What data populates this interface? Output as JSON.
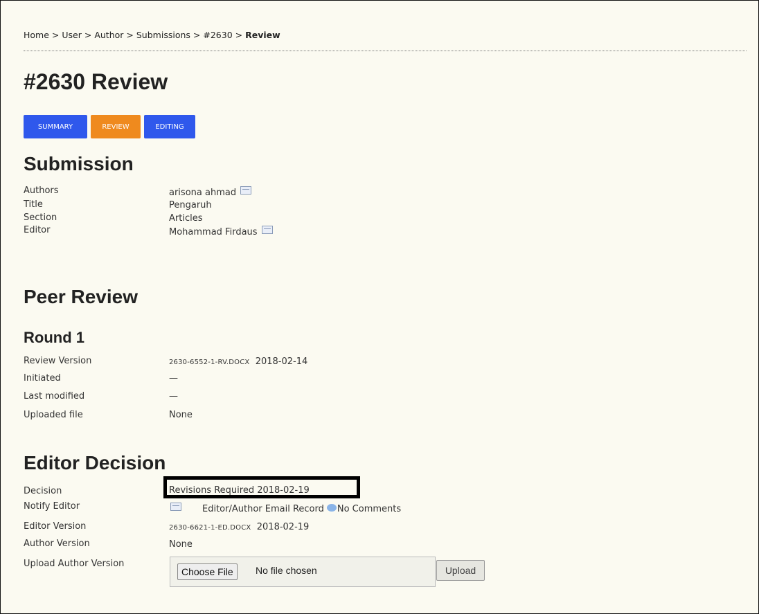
{
  "breadcrumb": {
    "items": [
      "Home",
      "User",
      "Author",
      "Submissions",
      "#2630"
    ],
    "separator": ">",
    "current": "Review"
  },
  "page_title": "#2630 Review",
  "tabs": [
    {
      "label": "SUMMARY",
      "active": false
    },
    {
      "label": "REVIEW",
      "active": true
    },
    {
      "label": "EDITING",
      "active": false
    }
  ],
  "submission": {
    "heading": "Submission",
    "rows": [
      {
        "label": "Authors",
        "value": "arisona ahmad",
        "icon": "mail-icon"
      },
      {
        "label": "Title",
        "value": "Pengaruh"
      },
      {
        "label": "Section",
        "value": "Articles"
      },
      {
        "label": "Editor",
        "value": "Mohammad Firdaus",
        "icon": "mail-icon"
      }
    ]
  },
  "peer_review": {
    "heading": "Peer Review",
    "round_heading": "Round 1",
    "rows": [
      {
        "label": "Review Version",
        "file": "2630-6552-1-RV.DOCX",
        "date": "2018-02-14"
      },
      {
        "label": "Initiated",
        "value": "—"
      },
      {
        "label": "Last modified",
        "value": "—"
      },
      {
        "label": "Uploaded file",
        "value": "None"
      }
    ]
  },
  "editor_decision": {
    "heading": "Editor Decision",
    "decision_label": "Decision",
    "decision_value": "Revisions Required 2018-02-19",
    "notify_label": "Notify Editor",
    "email_record": "Editor/Author Email Record",
    "comments": "No Comments",
    "editor_version_label": "Editor Version",
    "editor_version_file": "2630-6621-1-ED.DOCX",
    "editor_version_date": "2018-02-19",
    "author_version_label": "Author Version",
    "author_version_value": "None",
    "upload_label": "Upload Author Version",
    "choose_file": "Choose File",
    "no_file": "No file chosen",
    "upload_button": "Upload"
  },
  "colors": {
    "tab_blue": "#2f58ec",
    "tab_active_orange": "#ef8a1e",
    "page_bg": "#fbfaf1"
  }
}
